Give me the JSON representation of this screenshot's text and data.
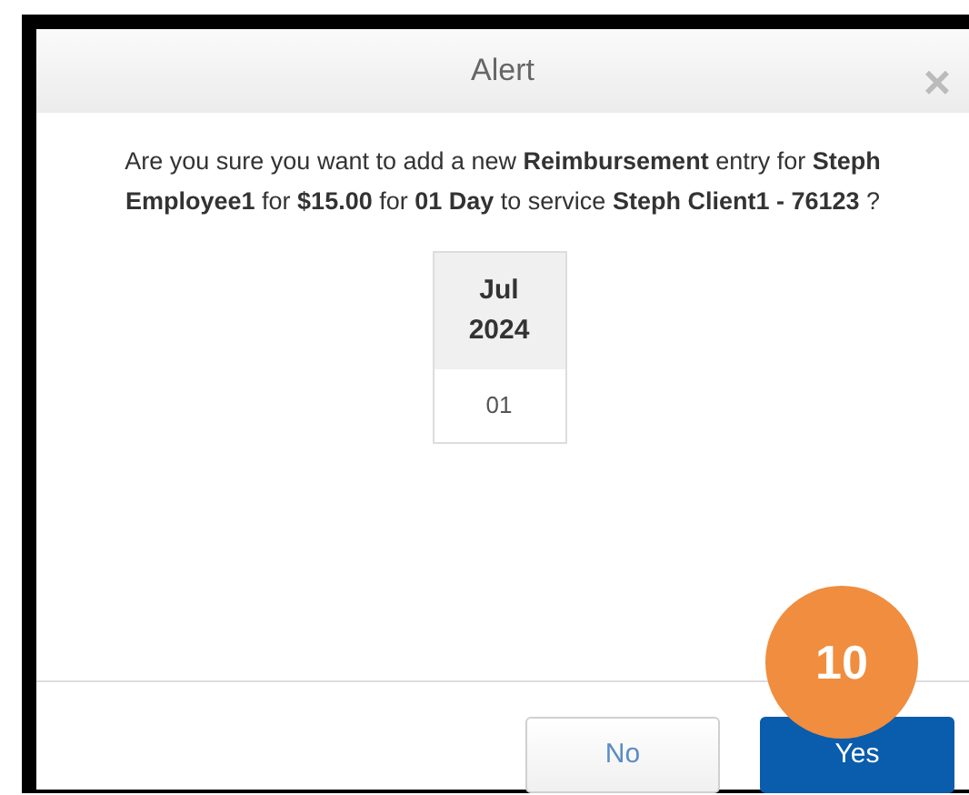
{
  "dialog": {
    "title": "Alert",
    "close": "×",
    "message": "Are you sure you want to add a new **Reimbursement** entry for **Steph Employee1** for **$15.00** for **01 Day** to service **Steph Client1 - 76123** ?",
    "calendar": {
      "month": "Jul",
      "year": "2024",
      "days": [
        "01"
      ]
    },
    "buttons": [
      {
        "label": "No",
        "kind": "secondary"
      },
      {
        "label": "Yes",
        "kind": "primary"
      }
    ],
    "step_badge": "10"
  }
}
